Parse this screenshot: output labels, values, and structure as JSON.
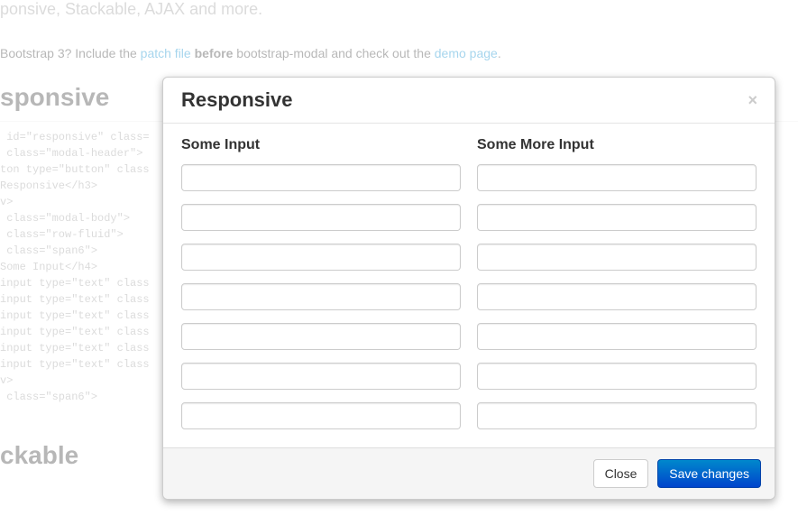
{
  "background": {
    "subtitle": "ponsive, Stackable, AJAX and more.",
    "note_prefix": "Bootstrap 3? Include the ",
    "note_link1": "patch file",
    "note_mid1": " ",
    "note_bold": "before",
    "note_mid2": " bootstrap-modal and check out the ",
    "note_link2": "demo page",
    "note_suffix": ".",
    "section1": "sponsive",
    "code": " id=\"responsive\" class=\n class=\"modal-header\">\nton type=\"button\" class\nResponsive</h3>\nv>\n class=\"modal-body\">\n class=\"row-fluid\">\n class=\"span6\">\nSome Input</h4>\ninput type=\"text\" class\ninput type=\"text\" class\ninput type=\"text\" class\ninput type=\"text\" class\ninput type=\"text\" class\ninput type=\"text\" class\nv>\n class=\"span6\">",
    "section2": "ckable"
  },
  "modal": {
    "title": "Responsive",
    "close_x": "×",
    "left_heading": "Some Input",
    "right_heading": "Some More Input",
    "close_label": "Close",
    "save_label": "Save changes"
  }
}
